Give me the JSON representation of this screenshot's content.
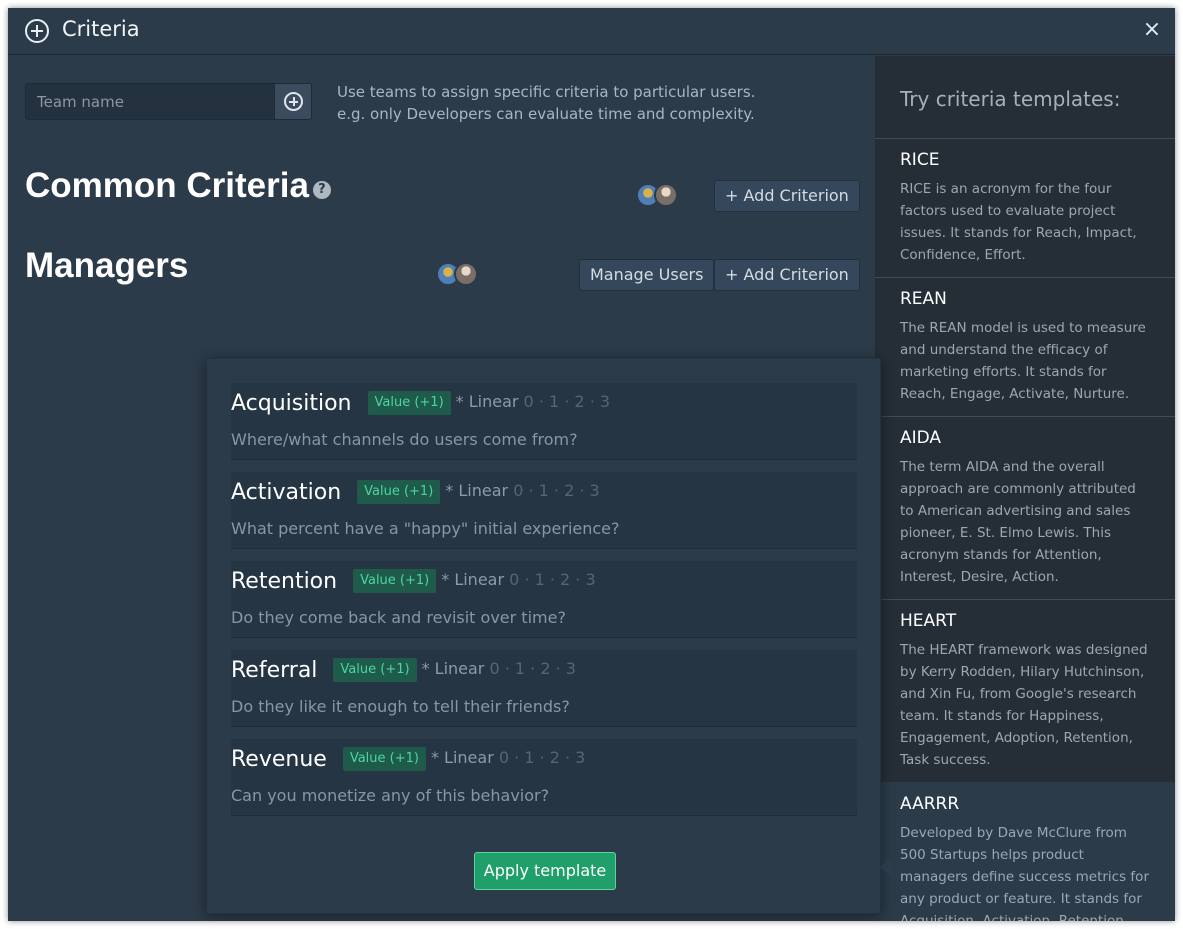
{
  "dialog": {
    "title": "Criteria",
    "close_glyph": "×"
  },
  "team": {
    "placeholder": "Team name",
    "hint_line1": "Use teams to assign specific criteria to particular users.",
    "hint_line2": "e.g. only Developers can evaluate time and complexity."
  },
  "common": {
    "heading": "Common Criteria",
    "help_glyph": "?",
    "add_label": "+ Add Criterion"
  },
  "managers": {
    "heading": "Managers",
    "manage_label": "Manage Users",
    "add_label": "+ Add Criterion"
  },
  "templates": {
    "header": "Try criteria templates:",
    "items": [
      {
        "name": "RICE",
        "description": "RICE is an acronym for the four factors used to evaluate project issues. It stands for Reach, Impact, Confidence, Effort."
      },
      {
        "name": "REAN",
        "description": "The REAN model is used to measure and understand the efficacy of marketing efforts. It stands for Reach, Engage, Activate, Nurture."
      },
      {
        "name": "AIDA",
        "description": "The term AIDA and the overall approach are commonly attributed to American advertising and sales pioneer, E. St. Elmo Lewis. This acronym stands for Attention, Interest, Desire, Action."
      },
      {
        "name": "HEART",
        "description": "The HEART framework was designed by Kerry Rodden, Hilary Hutchinson, and Xin Fu, from Google's research team. It stands for Happiness, Engagement, Adoption, Retention, Task success."
      },
      {
        "name": "AARRR",
        "description": "Developed by Dave McClure from 500 Startups helps product managers define success metrics for any product or feature. It stands for Acquisition, Activation, Retention, Referral,"
      }
    ]
  },
  "preview": {
    "criteria": [
      {
        "title": "Acquisition",
        "badge": "Value (+1)",
        "scale_label": "* Linear",
        "scale_values": "0 · 1 · 2 · 3",
        "description": "Where/what channels do users come from?"
      },
      {
        "title": "Activation",
        "badge": "Value (+1)",
        "scale_label": "* Linear",
        "scale_values": "0 · 1 · 2 · 3",
        "description": "What percent have a \"happy\" initial experience?"
      },
      {
        "title": "Retention",
        "badge": "Value (+1)",
        "scale_label": "* Linear",
        "scale_values": "0 · 1 · 2 · 3",
        "description": "Do they come back and revisit over time?"
      },
      {
        "title": "Referral",
        "badge": "Value (+1)",
        "scale_label": "* Linear",
        "scale_values": "0 · 1 · 2 · 3",
        "description": "Do they like it enough to tell their friends?"
      },
      {
        "title": "Revenue",
        "badge": "Value (+1)",
        "scale_label": "* Linear",
        "scale_values": "0 · 1 · 2 · 3",
        "description": "Can you monetize any of this behavior?"
      }
    ],
    "apply_label": "Apply template"
  },
  "colors": {
    "window_bg": "#2c3b4a",
    "sidebar_bg": "#252e37",
    "badge_bg": "#1e5b4a",
    "badge_text": "#4fd3a0",
    "primary_button": "#1fa06a"
  }
}
